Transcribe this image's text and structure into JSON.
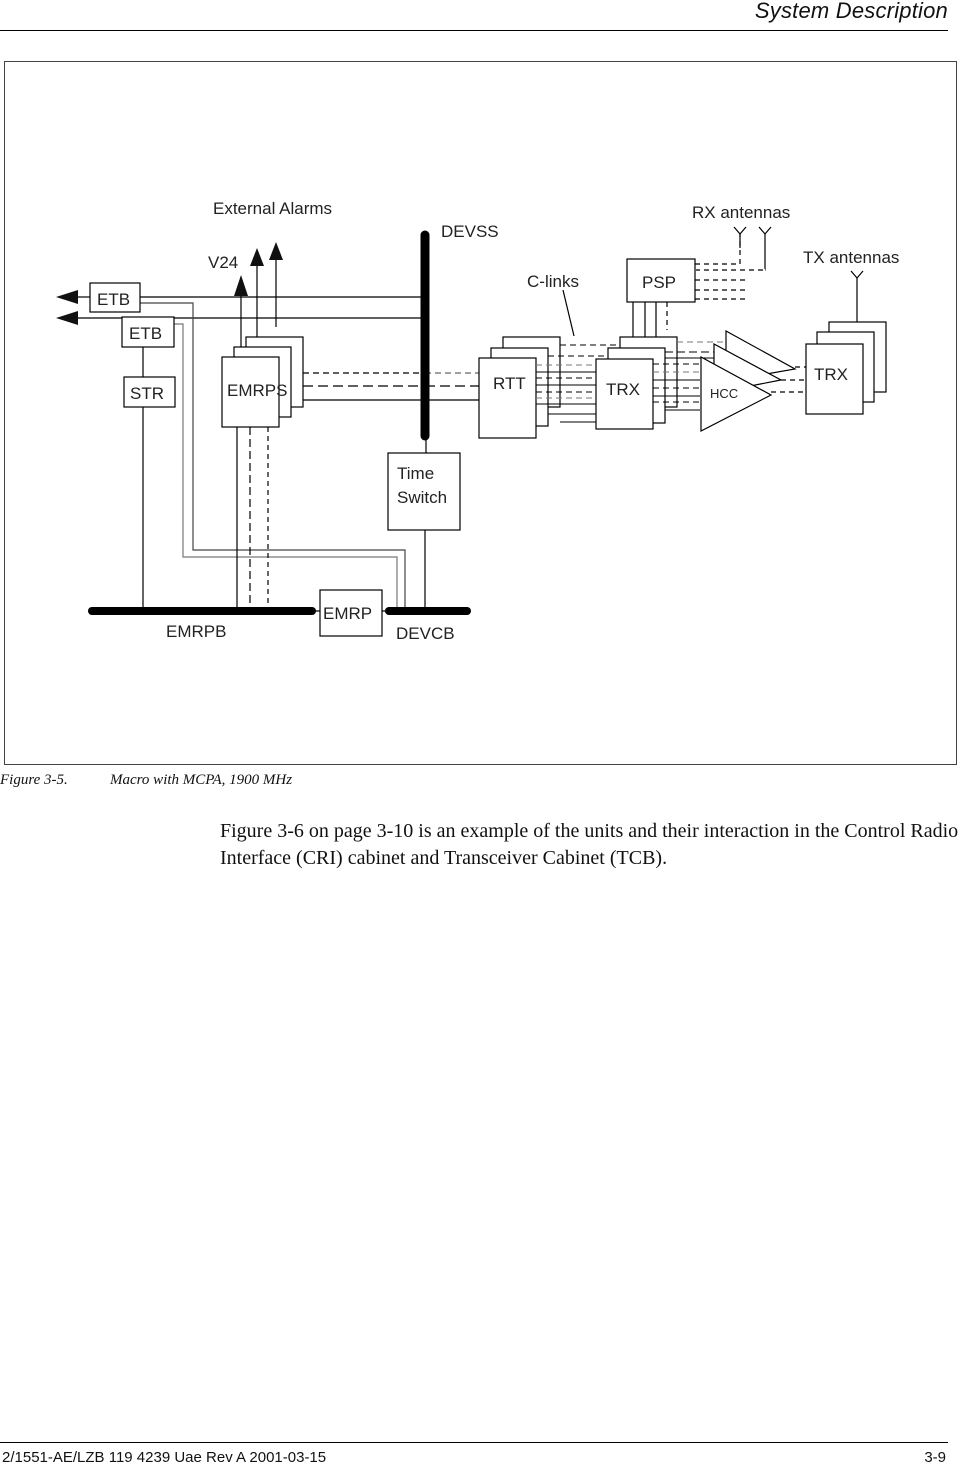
{
  "header": {
    "title": "System  Description"
  },
  "diagram": {
    "labels": {
      "external_alarms": "External Alarms",
      "v24": "V24",
      "devss": "DEVSS",
      "c_links": "C-links",
      "rx_antennas": "RX antennas",
      "tx_antennas": "TX antennas",
      "emrpb": "EMRPB",
      "devcb": "DEVCB"
    },
    "units": {
      "etb1": "ETB",
      "etb2": "ETB",
      "str": "STR",
      "emrps": "EMRPS",
      "psp": "PSP",
      "rtt": "RTT",
      "trx_mid": "TRX",
      "hcc": "HCC",
      "trx_right": "TRX",
      "time_switch_line1": "Time",
      "time_switch_line2": "Switch",
      "emrp": "EMRP"
    }
  },
  "caption": {
    "number": "Figure 3-5.",
    "text": "Macro with MCPA, 1900 MHz"
  },
  "body": {
    "paragraph": "Figure 3-6 on page 3-10 is an example of the units and their interaction in the Control Radio Interface (CRI) cabinet and Transceiver Cabinet (TCB)."
  },
  "footer": {
    "doc_id": "2/1551-AE/LZB 119 4239 Uae Rev A 2001-03-15",
    "page": "3-9"
  }
}
